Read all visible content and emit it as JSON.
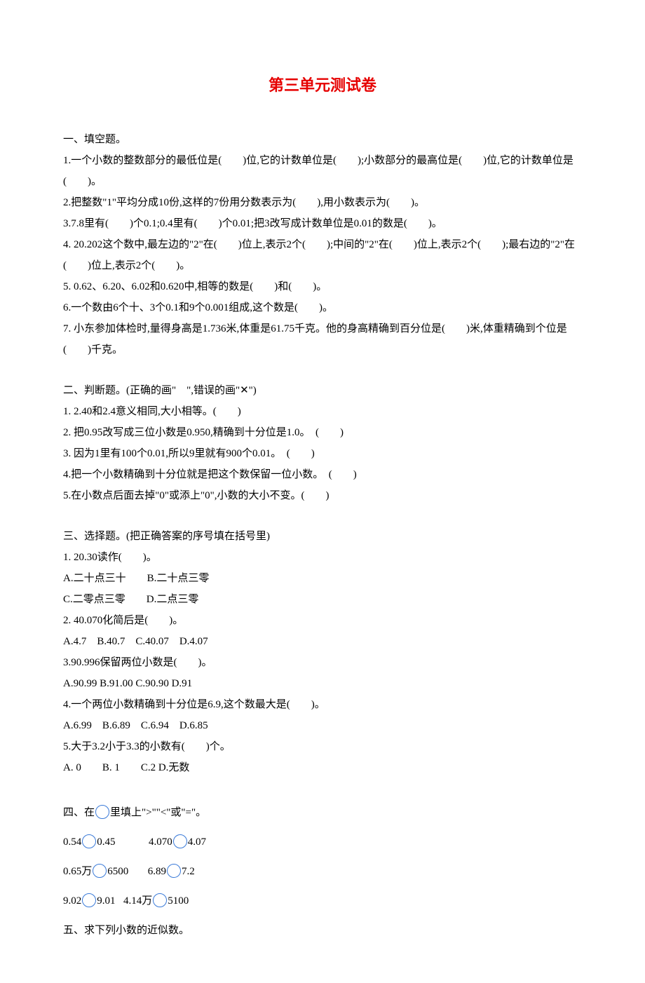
{
  "title": "第三单元测试卷",
  "s1": {
    "head": "一、填空题。",
    "q1": "1.一个小数的整数部分的最低位是(　　)位,它的计数单位是(　　);小数部分的最高位是(　　)位,它的计数单位是(　　)。",
    "q2": "2.把整数\"1\"平均分成10份,这样的7份用分数表示为(　　),用小数表示为(　　)。",
    "q3": "3.7.8里有(　　)个0.1;0.4里有(　　)个0.01;把3改写成计数单位是0.01的数是(　　)。",
    "q4": "4. 20.202这个数中,最左边的\"2\"在(　　)位上,表示2个(　　);中间的\"2\"在(　　)位上,表示2个(　　);最右边的\"2\"在(　　)位上,表示2个(　　)。",
    "q5": "5. 0.62、6.20、6.02和0.620中,相等的数是(　　)和(　　)。",
    "q6": "6.一个数由6个十、3个0.1和9个0.001组成,这个数是(　　)。",
    "q7": "7. 小东参加体检时,量得身高是1.736米,体重是61.75千克。他的身高精确到百分位是(　　)米,体重精确到个位是(　　)千克。"
  },
  "s2": {
    "head": "二、判断题。(正确的画\"　\",错误的画\"✕\")",
    "q1": "1. 2.40和2.4意义相同,大小相等。(　　)",
    "q2": "2. 把0.95改写成三位小数是0.950,精确到十分位是1.0。　(　　)",
    "q3": "3. 因为1里有100个0.01,所以9里就有900个0.01。　(　　)",
    "q4": "4.把一个小数精确到十分位就是把这个数保留一位小数。　(　　)",
    "q5": "5.在小数点后面去掉\"0\"或添上\"0\",小数的大小不变。(　　)"
  },
  "s3": {
    "head": "三、选择题。(把正确答案的序号填在括号里)",
    "q1": "1. 20.30读作(　　)。",
    "q1a": "A.二十点三十　　B.二十点三零",
    "q1b": "C.二零点三零　　D.二点三零",
    "q2": "2. 40.070化简后是(　　)。",
    "q2a": "A.4.7　B.40.7　C.40.07　D.4.07",
    "q3": "3.90.996保留两位小数是(　　)。",
    "q3a": "A.90.99 B.91.00 C.90.90 D.91",
    "q4": "4.一个两位小数精确到十分位是6.9,这个数最大是(　　)。",
    "q4a": "A.6.99　B.6.89　C.6.94　D.6.85",
    "q5": "5.大于3.2小于3.3的小数有(　　)个。",
    "q5a": "A. 0　　B. 1　　C.2 D.无数"
  },
  "s4": {
    "head_a": "四、在",
    "head_b": "里填上\">\"\"<\"或\"=\"。",
    "r1a": "0.54",
    "r1b": "0.45",
    "r1c": "4.070",
    "r1d": "4.07",
    "r2a": "0.65万",
    "r2b": "6500",
    "r2c": "6.89",
    "r2d": "7.2",
    "r3a": "9.02",
    "r3b": "9.01",
    "r3c": "4.14万",
    "r3d": "5100"
  },
  "s5": {
    "head": "五、求下列小数的近似数。"
  }
}
